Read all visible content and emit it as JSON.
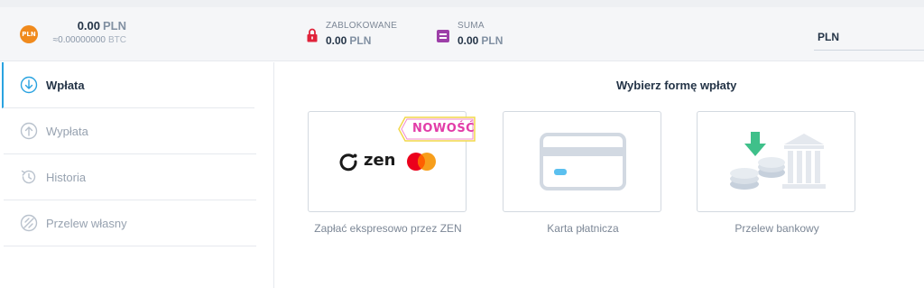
{
  "balance": {
    "coin_label": "PLN",
    "amount": "0.00",
    "currency": "PLN",
    "btc_amount": "≈0.00000000",
    "btc_currency": "BTC"
  },
  "stats": {
    "blocked_label": "ZABLOKOWANE",
    "blocked_amount": "0.00",
    "blocked_currency": "PLN",
    "sum_label": "SUMA",
    "sum_amount": "0.00",
    "sum_currency": "PLN"
  },
  "currency_select": {
    "value": "PLN"
  },
  "sidebar": {
    "items": [
      {
        "label": "Wpłata",
        "icon": "arrow-down-circle-icon",
        "active": true
      },
      {
        "label": "Wypłata",
        "icon": "arrow-up-circle-icon",
        "active": false
      },
      {
        "label": "Historia",
        "icon": "history-icon",
        "active": false
      },
      {
        "label": "Przelew własny",
        "icon": "transfer-icon",
        "active": false
      }
    ]
  },
  "main": {
    "title": "Wybierz formę wpłaty",
    "badge": "NOWOŚĆ",
    "zen_brand": "zen",
    "methods": [
      {
        "caption": "Zapłać ekspresowo przez ZEN",
        "icon": "zen-mastercard-logo"
      },
      {
        "caption": "Karta płatnicza",
        "icon": "card-icon"
      },
      {
        "caption": "Przelew bankowy",
        "icon": "bank-transfer-icon"
      }
    ]
  },
  "colors": {
    "accent": "#2aa3e0",
    "coin": "#f08a1d",
    "lock": "#e0233a",
    "sum": "#9d3fa8",
    "badge": "#e23ca8",
    "badge_border": "#f2d74a",
    "bank_arrow": "#3fc08a"
  }
}
